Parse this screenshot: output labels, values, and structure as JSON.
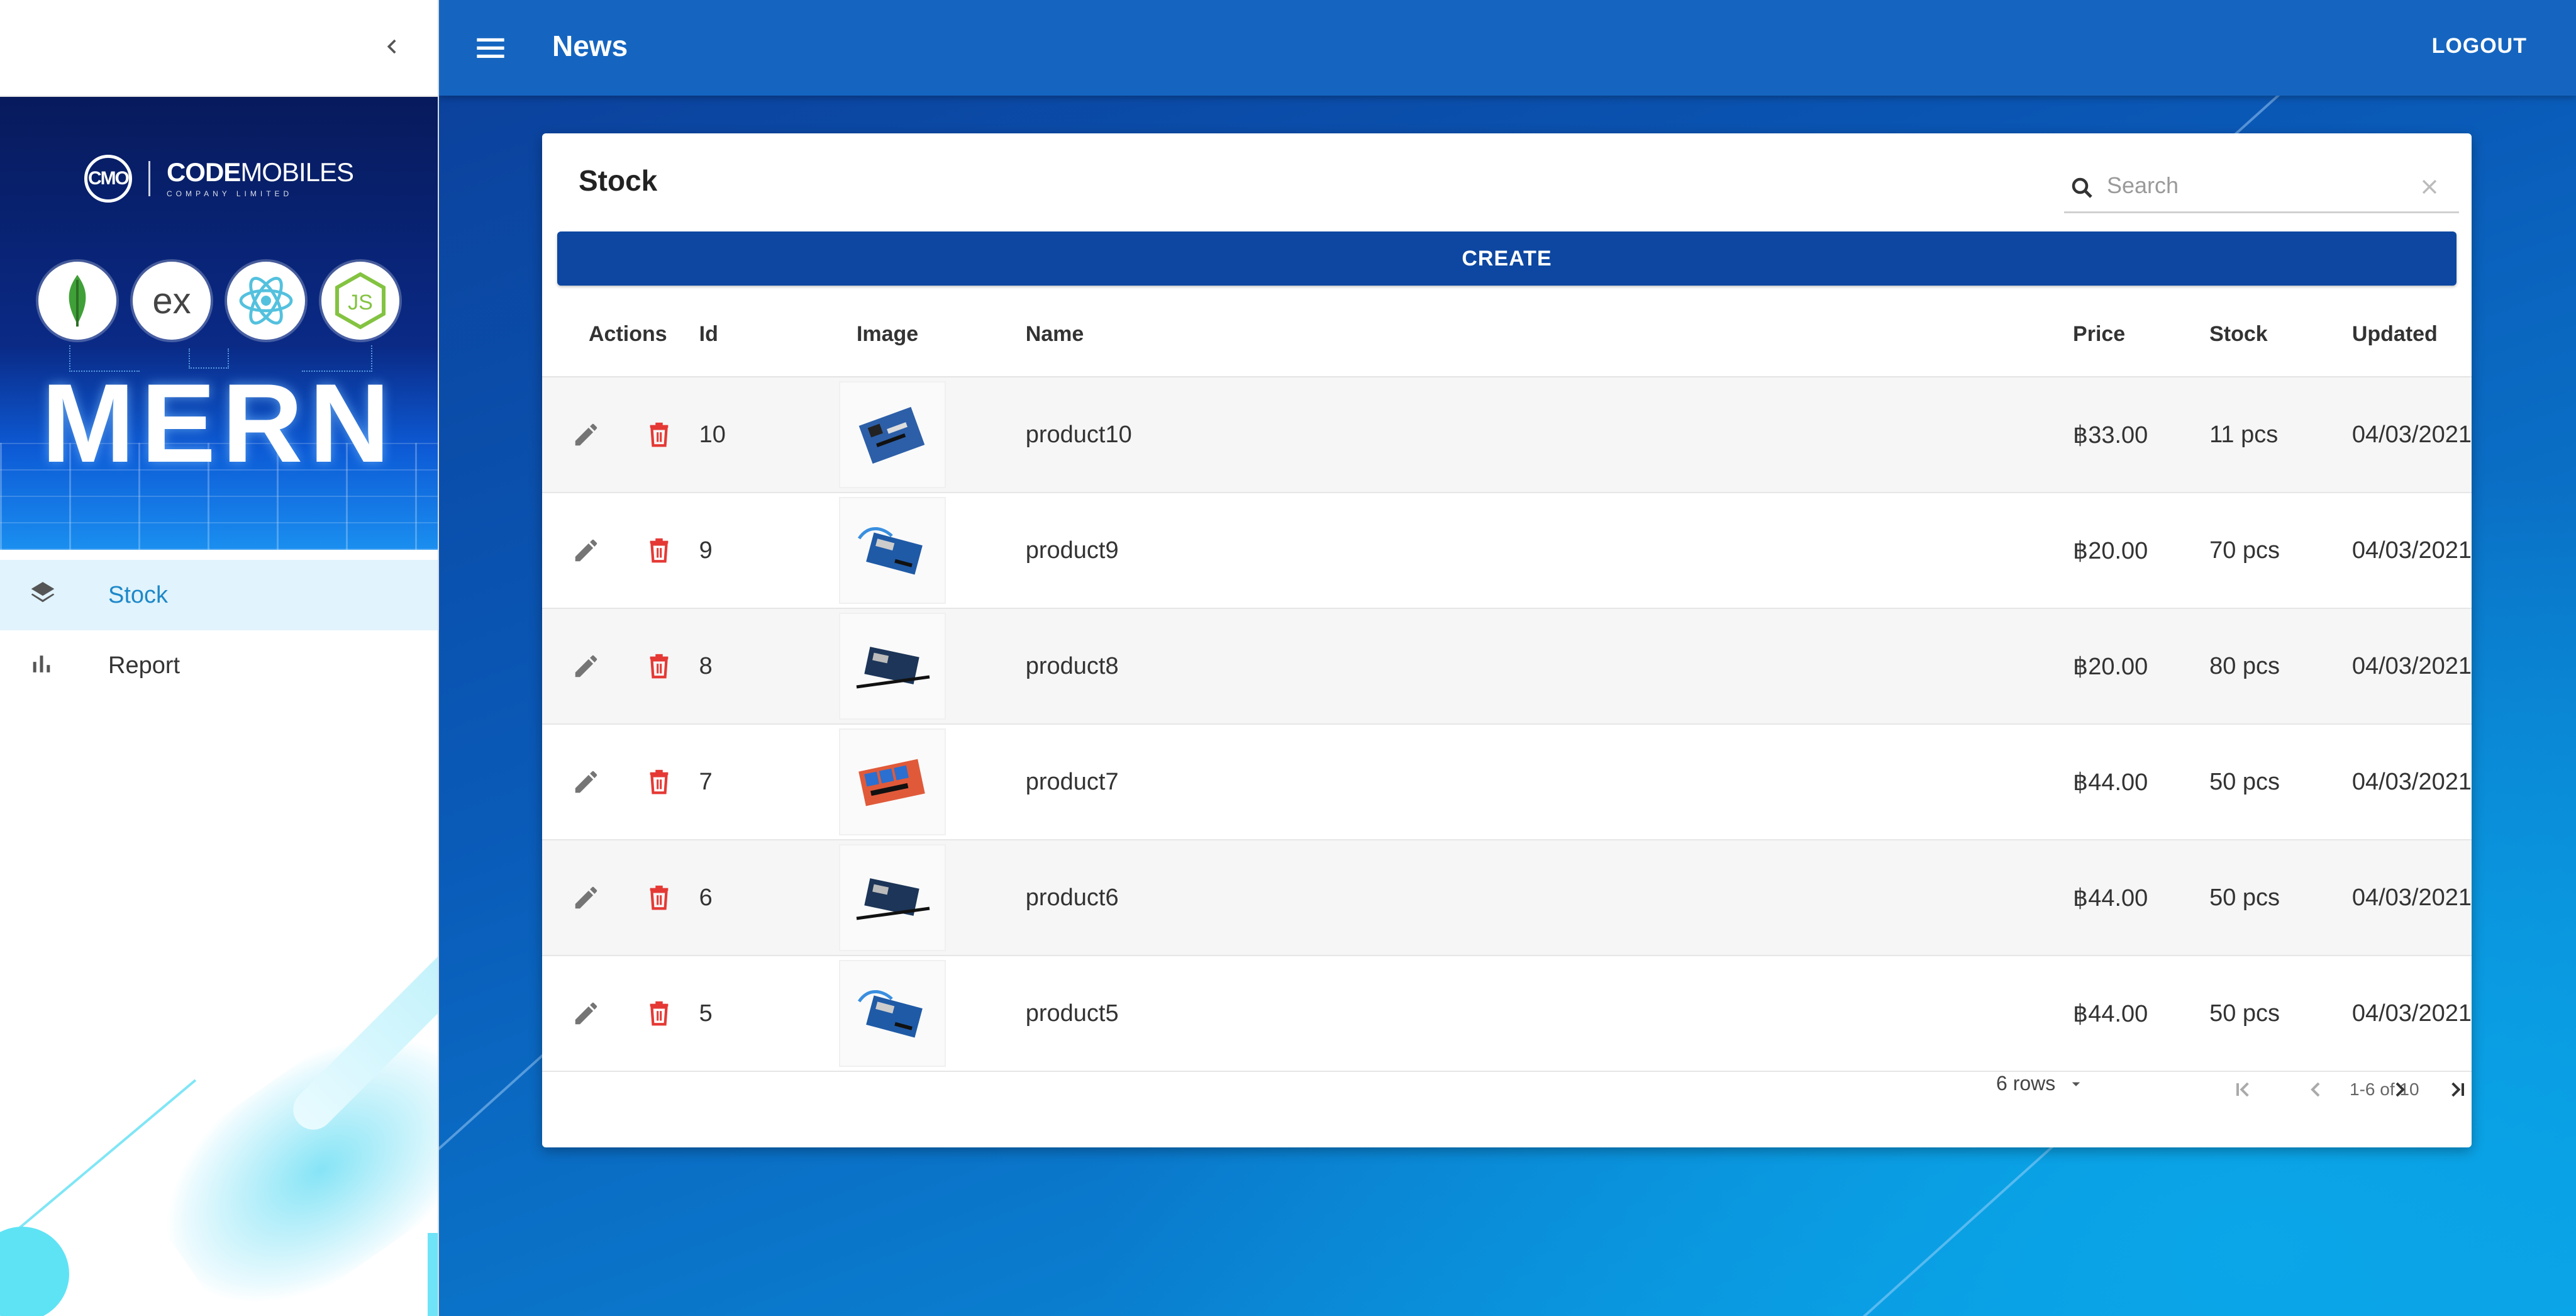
{
  "sidebar": {
    "banner": {
      "brand_logo": "CMO",
      "brand_name_bold": "CODE",
      "brand_name_light": "MOBILES",
      "brand_subtitle": "COMPANY LIMITED",
      "stack_icons": [
        "mongodb-icon",
        "express-icon",
        "react-icon",
        "nodejs-icon"
      ],
      "express_text": "ex",
      "node_text": "JS",
      "title": "MERN"
    },
    "items": [
      {
        "label": "Stock",
        "icon": "layers-icon",
        "active": true
      },
      {
        "label": "Report",
        "icon": "bar-chart-icon",
        "active": false
      }
    ]
  },
  "appbar": {
    "title": "News",
    "logout_label": "LOGOUT",
    "color": "#1565c0"
  },
  "stock": {
    "title": "Stock",
    "search_placeholder": "Search",
    "create_label": "CREATE",
    "create_color": "#0d47a1",
    "columns": [
      "Actions",
      "Id",
      "Image",
      "Name",
      "Price",
      "Stock",
      "Updated"
    ],
    "rows": [
      {
        "id": "10",
        "name": "product10",
        "price": "฿33.00",
        "stock": "11 pcs",
        "updated": "04/03/2021",
        "image": "shield-board"
      },
      {
        "id": "9",
        "name": "product9",
        "price": "฿20.00",
        "stock": "70 pcs",
        "updated": "04/03/2021",
        "image": "blue-board-cable"
      },
      {
        "id": "8",
        "name": "product8",
        "price": "฿20.00",
        "stock": "80 pcs",
        "updated": "04/03/2021",
        "image": "dark-board"
      },
      {
        "id": "7",
        "name": "product7",
        "price": "฿44.00",
        "stock": "50 pcs",
        "updated": "04/03/2021",
        "image": "relay-board"
      },
      {
        "id": "6",
        "name": "product6",
        "price": "฿44.00",
        "stock": "50 pcs",
        "updated": "04/03/2021",
        "image": "dark-board"
      },
      {
        "id": "5",
        "name": "product5",
        "price": "฿44.00",
        "stock": "50 pcs",
        "updated": "04/03/2021",
        "image": "blue-board-cable"
      }
    ],
    "pagination": {
      "rows_label": "6 rows",
      "range": "1-6 of 10"
    },
    "edit_icon": "pencil-icon",
    "delete_icon": "trash-icon",
    "delete_color": "#e53935"
  }
}
